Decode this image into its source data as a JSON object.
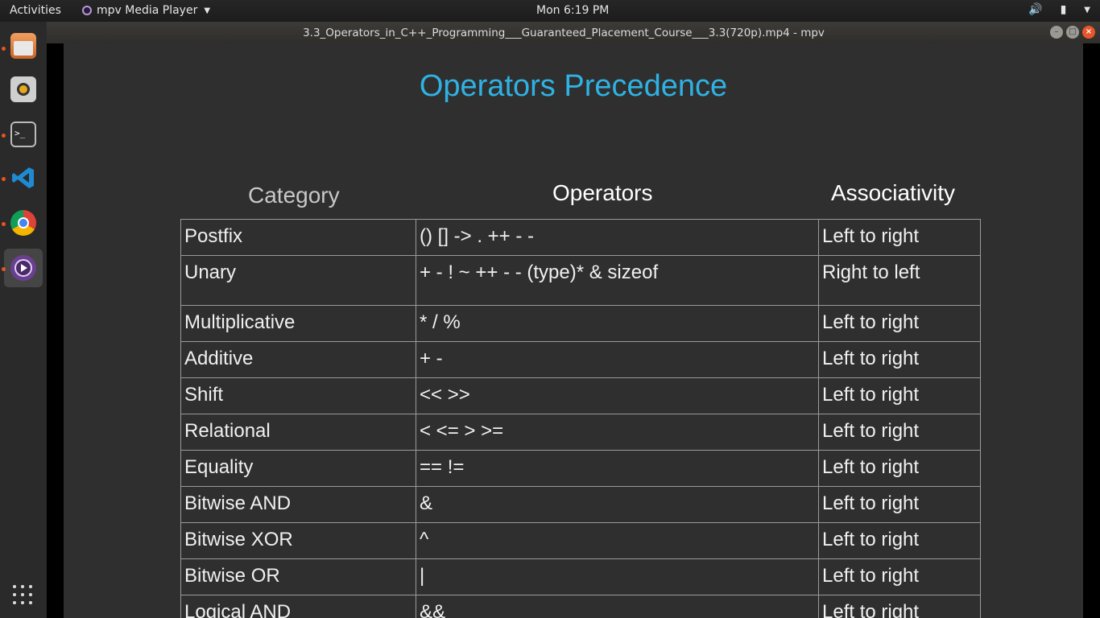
{
  "topbar": {
    "activities": "Activities",
    "app_name": "mpv Media Player",
    "clock": "Mon  6:19 PM"
  },
  "window": {
    "title": "3.3_Operators_in_C++_Programming___Guaranteed_Placement_Course___3.3(720p).mp4 - mpv"
  },
  "dock": {
    "items": [
      "files-icon",
      "rhythmbox-icon",
      "terminal-icon",
      "vscode-icon",
      "chrome-icon",
      "mpv-icon"
    ],
    "terminal_glyph": ">_"
  },
  "slide": {
    "title": "Operators Precedence",
    "headers": {
      "category": "Category",
      "operators": "Operators",
      "associativity": "Associativity"
    },
    "rows": [
      {
        "category": "Postfix",
        "operators": "() [] -> . ++ - -",
        "associativity": "Left to right"
      },
      {
        "category": "Unary",
        "operators": "+ - ! ~ ++ - - (type)* & sizeof",
        "associativity": "Right to left"
      },
      {
        "category": "Multiplicative",
        "operators": "* / %",
        "associativity": "Left to right"
      },
      {
        "category": "Additive",
        "operators": "+ -",
        "associativity": "Left to right"
      },
      {
        "category": "Shift",
        "operators": "<< >>",
        "associativity": "Left to right"
      },
      {
        "category": "Relational",
        "operators": "< <= > >=",
        "associativity": "Left to right"
      },
      {
        "category": "Equality",
        "operators": "== !=",
        "associativity": "Left to right"
      },
      {
        "category": "Bitwise AND",
        "operators": "&",
        "associativity": "Left to right"
      },
      {
        "category": "Bitwise XOR",
        "operators": "^",
        "associativity": "Left to right"
      },
      {
        "category": "Bitwise OR",
        "operators": "|",
        "associativity": "Left to right"
      },
      {
        "category": "Logical AND",
        "operators": "&&",
        "associativity": "Left to right"
      }
    ]
  },
  "colors": {
    "title_accent": "#2fb2e3",
    "slide_bg": "#2f2f2f",
    "close_button": "#e9552b"
  }
}
